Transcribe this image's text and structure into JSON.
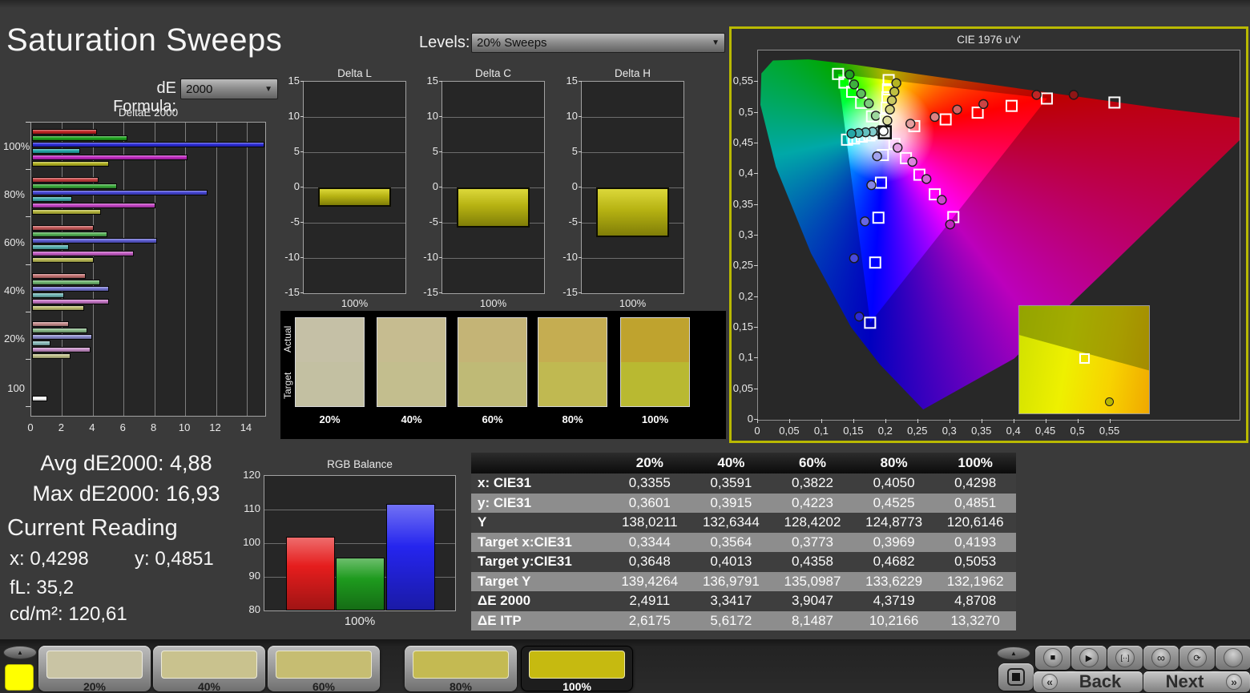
{
  "app": {
    "title": "Saturation Sweeps"
  },
  "controls": {
    "de_formula_label": "dE Formula:",
    "de_formula_value": "2000",
    "levels_label": "Levels:",
    "levels_value": "20% Sweeps",
    "dropdown_arrow": "▼"
  },
  "stats": {
    "avg": "Avg dE2000: 4,88",
    "max": "Max dE2000: 16,93",
    "current_reading_label": "Current Reading",
    "x_label": "x:",
    "x_value": "0,4298",
    "y_label": "y:",
    "y_value": "0,4851",
    "fl_label": "fL:",
    "fl_value": "35,2",
    "cdm2_label": "cd/m²:",
    "cdm2_value": "120,61"
  },
  "swatch_panel": {
    "row_labels": [
      "Actual",
      "Target"
    ],
    "items": [
      {
        "label": "20%",
        "actual": "#c5c0a6",
        "target": "#c3c0a2"
      },
      {
        "label": "40%",
        "actual": "#c6bc90",
        "target": "#c3be8e"
      },
      {
        "label": "60%",
        "actual": "#c4b476",
        "target": "#bfba76"
      },
      {
        "label": "80%",
        "actual": "#c5ad51",
        "target": "#c0b951"
      },
      {
        "label": "100%",
        "actual": "#bfa32e",
        "target": "#b9b931"
      }
    ]
  },
  "table": {
    "col_headers": [
      "",
      "20%",
      "40%",
      "60%",
      "80%",
      "100%"
    ],
    "rows": [
      {
        "label": "x: CIE31",
        "values": [
          "0,3355",
          "0,3591",
          "0,3822",
          "0,4050",
          "0,4298"
        ]
      },
      {
        "label": "y: CIE31",
        "values": [
          "0,3601",
          "0,3915",
          "0,4223",
          "0,4525",
          "0,4851"
        ]
      },
      {
        "label": "Y",
        "values": [
          "138,0211",
          "132,6344",
          "128,4202",
          "124,8773",
          "120,6146"
        ]
      },
      {
        "label": "Target x:CIE31",
        "values": [
          "0,3344",
          "0,3564",
          "0,3773",
          "0,3969",
          "0,4193"
        ]
      },
      {
        "label": "Target y:CIE31",
        "values": [
          "0,3648",
          "0,4013",
          "0,4358",
          "0,4682",
          "0,5053"
        ]
      },
      {
        "label": "Target Y",
        "values": [
          "139,4264",
          "136,9791",
          "135,0987",
          "133,6229",
          "132,1962"
        ]
      },
      {
        "label": "ΔE 2000",
        "values": [
          "2,4911",
          "3,3417",
          "3,9047",
          "4,3719",
          "4,8708"
        ]
      },
      {
        "label": "ΔE ITP",
        "values": [
          "2,6175",
          "5,6172",
          "8,1487",
          "10,2166",
          "13,3270"
        ]
      }
    ]
  },
  "bottom_bar": {
    "reference_swatch_color": "#ffff00",
    "samples": [
      {
        "label": "20%",
        "color": "#c9c4a4",
        "selected": false
      },
      {
        "label": "40%",
        "color": "#c9c28e",
        "selected": false
      },
      {
        "label": "60%",
        "color": "#c6bd72",
        "selected": false
      },
      {
        "label": "80%",
        "color": "#c4ba52",
        "selected": false
      },
      {
        "label": "100%",
        "color": "#c6ba10",
        "selected": true
      }
    ],
    "transport": [
      {
        "name": "stop",
        "glyph": "■"
      },
      {
        "name": "play",
        "glyph": "▶"
      },
      {
        "name": "step",
        "glyph": "[··]"
      },
      {
        "name": "infinite",
        "glyph": "∞"
      },
      {
        "name": "refresh",
        "glyph": "⟳"
      },
      {
        "name": "record",
        "glyph": ""
      }
    ],
    "up_arrow_glyph": "▲",
    "back_glyph": "«",
    "back_label": "Back",
    "next_label": "Next",
    "next_glyph": "»"
  },
  "chart_data": [
    {
      "id": "deltae2000",
      "type": "bar",
      "orientation": "horizontal",
      "title": "DeltaE 2000",
      "xlim": [
        0,
        15.2
      ],
      "xticks": [
        0,
        2,
        4,
        6,
        8,
        10,
        12,
        14
      ],
      "series_colors": {
        "red": "#c22525",
        "green": "#1fa41f",
        "blue": "#2b2bd8",
        "cyan": "#25a8a8",
        "magenta": "#c229c2",
        "yellow": "#b4b422",
        "white": "#ffffff"
      },
      "groups": [
        {
          "label": "100%",
          "sat": 1.0,
          "bars": [
            [
              "red",
              4.2
            ],
            [
              "green",
              6.2
            ],
            [
              "blue",
              15.1
            ],
            [
              "cyan",
              3.1
            ],
            [
              "magenta",
              10.1
            ],
            [
              "yellow",
              5.0
            ]
          ]
        },
        {
          "label": "80%",
          "sat": 0.8,
          "bars": [
            [
              "red",
              4.3
            ],
            [
              "green",
              5.5
            ],
            [
              "blue",
              11.4
            ],
            [
              "cyan",
              2.6
            ],
            [
              "magenta",
              8.0
            ],
            [
              "yellow",
              4.5
            ]
          ]
        },
        {
          "label": "60%",
          "sat": 0.6,
          "bars": [
            [
              "red",
              4.0
            ],
            [
              "green",
              4.9
            ],
            [
              "blue",
              8.1
            ],
            [
              "cyan",
              2.4
            ],
            [
              "magenta",
              6.6
            ],
            [
              "yellow",
              4.0
            ]
          ]
        },
        {
          "label": "40%",
          "sat": 0.4,
          "bars": [
            [
              "red",
              3.5
            ],
            [
              "green",
              4.4
            ],
            [
              "blue",
              5.0
            ],
            [
              "cyan",
              2.1
            ],
            [
              "magenta",
              5.0
            ],
            [
              "yellow",
              3.4
            ]
          ]
        },
        {
          "label": "20%",
          "sat": 0.2,
          "bars": [
            [
              "red",
              2.4
            ],
            [
              "green",
              3.6
            ],
            [
              "blue",
              3.9
            ],
            [
              "cyan",
              1.2
            ],
            [
              "magenta",
              3.8
            ],
            [
              "yellow",
              2.5
            ]
          ]
        },
        {
          "label": "100",
          "sat": 1.0,
          "bars": [
            [
              "white",
              1.0
            ]
          ]
        }
      ]
    },
    {
      "id": "delta_l",
      "type": "bar",
      "title": "Delta L",
      "categories": [
        "100%"
      ],
      "values": [
        -2.7
      ],
      "ylim": [
        -15,
        15
      ],
      "yticks": [
        15,
        10,
        5,
        0,
        -5,
        -10,
        -15
      ],
      "bar_color": "#c8c413"
    },
    {
      "id": "delta_c",
      "type": "bar",
      "title": "Delta C",
      "categories": [
        "100%"
      ],
      "values": [
        -5.7
      ],
      "ylim": [
        -15,
        15
      ],
      "yticks": [
        15,
        10,
        5,
        0,
        -5,
        -10,
        -15
      ],
      "bar_color": "#c8c413"
    },
    {
      "id": "delta_h",
      "type": "bar",
      "title": "Delta H",
      "categories": [
        "100%"
      ],
      "values": [
        -7.1
      ],
      "ylim": [
        -15,
        15
      ],
      "yticks": [
        15,
        10,
        5,
        0,
        -5,
        -10,
        -15
      ],
      "bar_color": "#c8c413"
    },
    {
      "id": "rgb_balance",
      "type": "bar",
      "title": "RGB Balance",
      "categories": [
        "100%"
      ],
      "ylim": [
        80,
        120
      ],
      "yticks": [
        120,
        110,
        100,
        90,
        80
      ],
      "series": [
        {
          "name": "red",
          "color": "#e51d1d",
          "values": [
            101.9
          ]
        },
        {
          "name": "green",
          "color": "#1e9b1e",
          "values": [
            95.7
          ]
        },
        {
          "name": "blue",
          "color": "#2525ee",
          "values": [
            111.7
          ]
        }
      ]
    },
    {
      "id": "cie",
      "type": "scatter",
      "title": "CIE 1976 u'v'",
      "xlim": [
        0,
        0.752
      ],
      "ylim": [
        0,
        0.6012
      ],
      "xtick_values": [
        0,
        0.05,
        0.1,
        0.15,
        0.2,
        0.25,
        0.3,
        0.35,
        0.4,
        0.45,
        0.5,
        0.55
      ],
      "xtick_labels": [
        "0",
        "0,05",
        "0,1",
        "0,15",
        "0,2",
        "0,25",
        "0,3",
        "0,35",
        "0,4",
        "0,45",
        "0,5",
        "0,55"
      ],
      "ytick_values": [
        0,
        0.05,
        0.1,
        0.15,
        0.2,
        0.25,
        0.3,
        0.35,
        0.4,
        0.45,
        0.5,
        0.55
      ],
      "ytick_labels": [
        "0",
        "0,05",
        "0,1",
        "0,15",
        "0,2",
        "0,25",
        "0,3",
        "0,35",
        "0,4",
        "0,45",
        "0,5",
        "0,55"
      ],
      "white_point": {
        "target": [
          0.198,
          0.468
        ],
        "measured": [
          0.196,
          0.47
        ]
      },
      "gamut_triangle": {
        "red": [
          0.451,
          0.523
        ],
        "green": [
          0.125,
          0.5625
        ],
        "blue": [
          0.175,
          0.158
        ]
      },
      "extra_targets": [
        {
          "name": "wide-gamut-red",
          "point": [
            0.5566,
            0.5165
          ],
          "measured": [
            0.493,
            0.529
          ]
        }
      ],
      "series": [
        {
          "name": "red",
          "color": "#c22525",
          "targets": [
            [
              0.244,
              0.478
            ],
            [
              0.293,
              0.489
            ],
            [
              0.343,
              0.5
            ],
            [
              0.396,
              0.511
            ],
            [
              0.451,
              0.523
            ]
          ],
          "measured": [
            [
              0.238,
              0.482
            ],
            [
              0.276,
              0.493
            ],
            [
              0.311,
              0.505
            ],
            [
              0.352,
              0.514
            ],
            [
              0.435,
              0.529
            ]
          ]
        },
        {
          "name": "green",
          "color": "#1fa41f",
          "targets": [
            [
              0.178,
              0.494
            ],
            [
              0.161,
              0.516
            ],
            [
              0.147,
              0.534
            ],
            [
              0.135,
              0.549
            ],
            [
              0.125,
              0.563
            ]
          ],
          "measured": [
            [
              0.184,
              0.495
            ],
            [
              0.173,
              0.515
            ],
            [
              0.161,
              0.531
            ],
            [
              0.15,
              0.546
            ],
            [
              0.143,
              0.562
            ]
          ]
        },
        {
          "name": "blue",
          "color": "#2b2bd8",
          "targets": [
            [
              0.195,
              0.431
            ],
            [
              0.192,
              0.386
            ],
            [
              0.188,
              0.329
            ],
            [
              0.183,
              0.256
            ],
            [
              0.175,
              0.158
            ]
          ],
          "measured": [
            [
              0.186,
              0.429
            ],
            [
              0.177,
              0.382
            ],
            [
              0.167,
              0.323
            ],
            [
              0.15,
              0.263
            ],
            [
              0.158,
              0.168
            ]
          ]
        },
        {
          "name": "cyan",
          "color": "#25a8a8",
          "targets": [
            [
              0.186,
              0.466
            ],
            [
              0.174,
              0.463
            ],
            [
              0.162,
              0.461
            ],
            [
              0.15,
              0.458
            ],
            [
              0.139,
              0.456
            ]
          ],
          "measured": [
            [
              0.189,
              0.47
            ],
            [
              0.179,
              0.469
            ],
            [
              0.168,
              0.468
            ],
            [
              0.157,
              0.467
            ],
            [
              0.146,
              0.466
            ]
          ]
        },
        {
          "name": "magenta",
          "color": "#c229c2",
          "targets": [
            [
              0.213,
              0.449
            ],
            [
              0.231,
              0.426
            ],
            [
              0.252,
              0.399
            ],
            [
              0.276,
              0.367
            ],
            [
              0.305,
              0.33
            ]
          ],
          "measured": [
            [
              0.218,
              0.443
            ],
            [
              0.241,
              0.42
            ],
            [
              0.263,
              0.392
            ],
            [
              0.287,
              0.358
            ],
            [
              0.3,
              0.318
            ]
          ]
        },
        {
          "name": "yellow",
          "color": "#b4b422",
          "targets": [
            [
              0.199,
              0.489
            ],
            [
              0.201,
              0.508
            ],
            [
              0.202,
              0.525
            ],
            [
              0.203,
              0.538
            ],
            [
              0.204,
              0.553
            ]
          ],
          "measured": [
            [
              0.202,
              0.487
            ],
            [
              0.206,
              0.505
            ],
            [
              0.209,
              0.52
            ],
            [
              0.213,
              0.534
            ],
            [
              0.216,
              0.548
            ]
          ]
        }
      ]
    }
  ]
}
